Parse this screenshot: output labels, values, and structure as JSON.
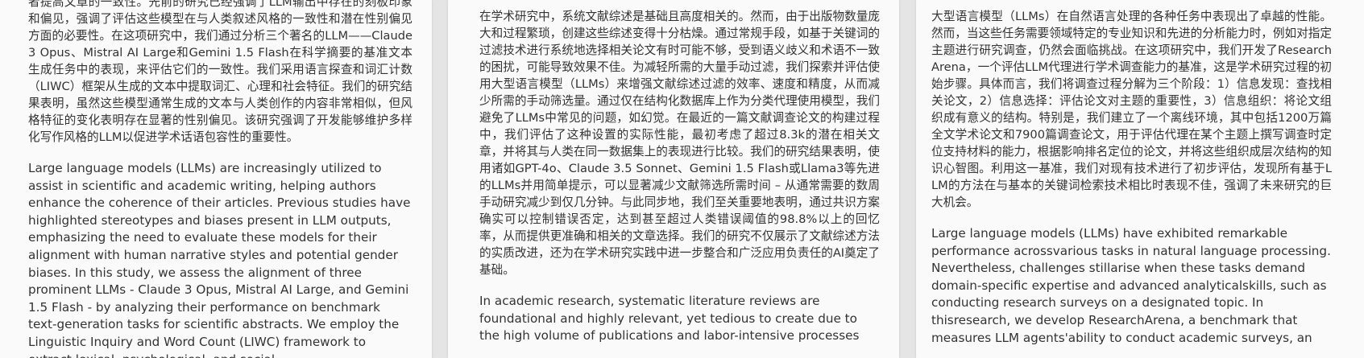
{
  "pages": [
    {
      "zh": "者提高文章的一致性。先前的研究已经强调了LLM输出中存在的刻板印象和偏见，强调了评估这些模型在与人类叙述风格的一致性和潜在性别偏见方面的必要性。在这项研究中，我们通过分析三个著名的LLM——Claude 3 Opus、Mistral AI Large和Gemini 1.5 Flash在科学摘要的基准文本生成任务中的表现，来评估它们的一致性。我们采用语言探查和词汇计数（LIWC）框架从生成的文本中提取词汇、心理和社会特征。我们的研究结果表明，虽然这些模型通常生成的文本与人类创作的内容非常相似，但风格特征的变化表明存在显著的性别偏见。该研究强调了开发能够维护多样化写作风格的LLM以促进学术话语包容性的重要性。",
      "en": "Large language models (LLMs) are increasingly utilized to assist in scientific and academic writing, helping authors enhance the coherence of their articles. Previous studies have highlighted stereotypes and biases present in LLM outputs, emphasizing the need to evaluate these models for their alignment with human narrative styles and potential gender biases. In this study, we assess the alignment of three prominent LLMs - Claude 3 Opus, Mistral AI Large, and Gemini 1.5 Flash - by analyzing their performance on benchmark text-generation tasks for scientific abstracts. We employ the Linguistic Inquiry and Word Count (LIWC) framework to extract lexical, psychological, and social"
    },
    {
      "zh": "在学术研究中，系统文献综述是基础且高度相关的。然而，由于出版物数量庞大和过程繁琐，创建这些综述变得十分枯燥。通过常规手段，如基于关键词的过滤技术进行系统地选择相关论文有时可能不够，受到语义歧义和术语不一致的困扰，可能导致效果不佳。为减轻所需的大量手动过滤，我们探索并评估使用大型语言模型（LLMs）来增强文献综述过滤的效率、速度和精度，从而减少所需的手动筛选量。通过仅在结构化数据库上作为分类代理使用模型，我们避免了LLMs中常见的问题，如幻觉。在最近的一篇文献调查论文的构建过程中，我们评估了这种设置的实际性能，最初考虑了超过8.3k的潜在相关文章，并将其与人类在同一数据集上的表现进行比较。我们的研究结果表明，使用诸如GPT-4o、Claude 3.5 Sonnet、Gemini 1.5 Flash或Llama3等先进的LLMs并用简单提示，可以显著减少文献筛选所需时间 – 从通常需要的数周手动研究减少到仅几分钟。与此同步地，我们至关重要地表明，通过共识方案确实可以控制错误否定，达到甚至超过人类错误阈值的98.8%以上的回忆率，从而提供更准确和相关的文章选择。我们的研究不仅展示了文献综述方法的实质改进，还为在学术研究实践中进一步整合和广泛应用负责任的AI奠定了基础。",
      "en": "In academic research, systematic literature reviews are foundational and highly relevant, yet tedious to create due to the high volume of publications and labor-intensive processes"
    },
    {
      "zh": "大型语言模型（LLMs）在自然语言处理的各种任务中表现出了卓越的性能。然而，当这些任务需要领域特定的专业知识和先进的分析能力时，例如对指定主题进行研究调查，仍然会面临挑战。在这项研究中，我们开发了ResearchArena，一个评估LLM代理进行学术调查能力的基准，这是学术研究过程的初始步骤。具体而言，我们将调查过程分解为三个阶段：1）信息发现：查找相关论文，2）信息选择：评估论文对主题的重要性，3）信息组织：将论文组织成有意义的结构。特别是，我们建立了一个离线环境，其中包括1200万篇全文学术论文和7900篇调查论文，用于评估代理在某个主题上撰写调查时定位支持材料的能力，根据影响排名定位的论文，并将这些组织成层次结构的知识心智图。利用这一基准，我们对现有技术进行了初步评估，发现所有基于LLM的方法在与基本的关键词检索技术相比时表现不佳，强调了未来研究的巨大机会。",
      "en": "Large language models (LLMs) have exhibited remarkable performance acrossvarious tasks in natural language processing. Nevertheless, challenges stillarise when these tasks demand domain-specific expertise and advanced analyticalskills, such as conducting research surveys on a designated topic. In thisresearch, we develop ResearchArena, a benchmark that measures LLM agents'ability to conduct academic surveys, an"
    }
  ]
}
